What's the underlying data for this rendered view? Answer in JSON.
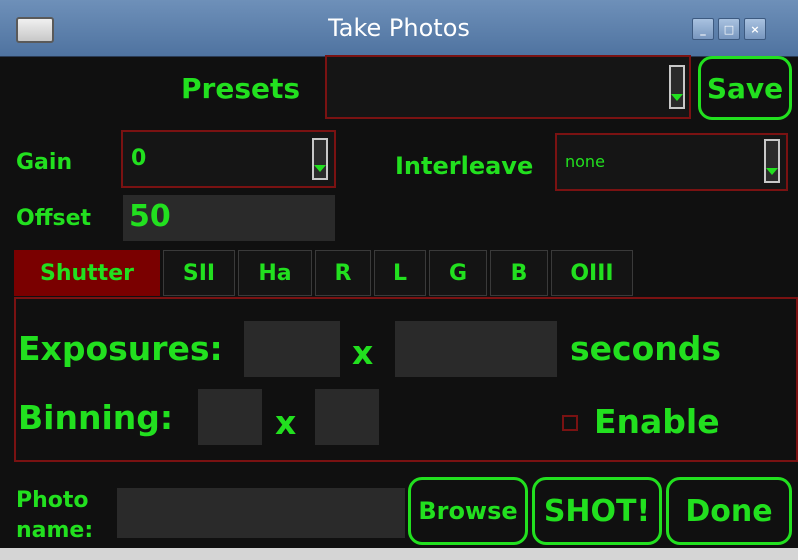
{
  "window": {
    "title": "Take Photos"
  },
  "presets": {
    "label": "Presets",
    "value": "",
    "save_label": "Save"
  },
  "gain": {
    "label": "Gain",
    "value": "0"
  },
  "interleave": {
    "label": "Interleave",
    "value": "none"
  },
  "offset": {
    "label": "Offset",
    "value": "50"
  },
  "tabs": [
    {
      "label": "Shutter",
      "active": true
    },
    {
      "label": "SII",
      "active": false
    },
    {
      "label": "Ha",
      "active": false
    },
    {
      "label": "R",
      "active": false
    },
    {
      "label": "L",
      "active": false
    },
    {
      "label": "G",
      "active": false
    },
    {
      "label": "B",
      "active": false
    },
    {
      "label": "OIII",
      "active": false
    }
  ],
  "panel": {
    "exposures_label": "Exposures:",
    "exposures_count": "",
    "x_label": "x",
    "exposure_seconds": "",
    "seconds_label": "seconds",
    "binning_label": "Binning:",
    "binning_x": "",
    "binning_y": "",
    "enable_label": "Enable",
    "enable_checked": false
  },
  "photo": {
    "label": "Photo name:",
    "value": ""
  },
  "buttons": {
    "browse": "Browse",
    "shot": "SHOT!",
    "done": "Done"
  },
  "colors": {
    "accent": "#22e01f",
    "border": "#7a1212",
    "tab_active": "#7a0000",
    "background": "#101010"
  }
}
